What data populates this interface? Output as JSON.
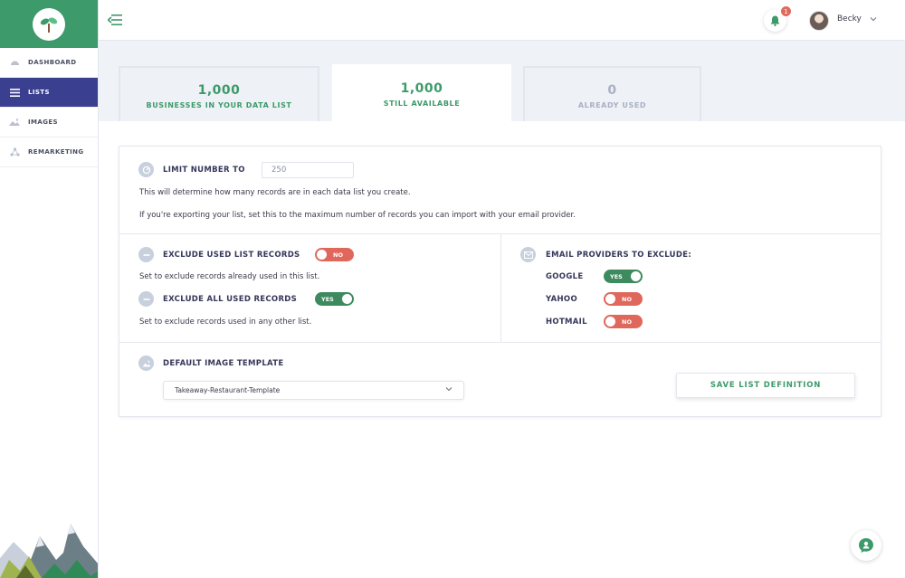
{
  "sidebar": {
    "items": [
      {
        "label": "DASHBOARD",
        "icon": "gauge-icon",
        "active": false
      },
      {
        "label": "LISTS",
        "icon": "list-icon",
        "active": true
      },
      {
        "label": "IMAGES",
        "icon": "image-icon",
        "active": false
      },
      {
        "label": "REMARKETING",
        "icon": "network-icon",
        "active": false
      }
    ]
  },
  "header": {
    "notification_count": "1",
    "user_name": "Becky"
  },
  "stats": [
    {
      "value": "1,000",
      "label": "BUSINESSES IN YOUR DATA LIST"
    },
    {
      "value": "1,000",
      "label": "STILL AVAILABLE"
    },
    {
      "value": "0",
      "label": "ALREADY USED"
    }
  ],
  "limit": {
    "label": "LIMIT NUMBER TO",
    "value": "250",
    "help1": "This will determine how many records are in each data list you create.",
    "help2": "If you're exporting your list, set this to the maximum number of records you can import with your email provider."
  },
  "exclude_used": {
    "label": "EXCLUDE USED LIST RECORDS",
    "toggle": "NO",
    "help": "Set to exclude records already used in this list."
  },
  "exclude_all": {
    "label": "EXCLUDE ALL USED RECORDS",
    "toggle": "YES",
    "help": "Set to exclude records used in any other list."
  },
  "providers": {
    "label": "EMAIL PROVIDERS TO EXCLUDE:",
    "items": [
      {
        "name": "GOOGLE",
        "toggle": "YES"
      },
      {
        "name": "YAHOO",
        "toggle": "NO"
      },
      {
        "name": "HOTMAIL",
        "toggle": "NO"
      }
    ]
  },
  "template": {
    "label": "DEFAULT IMAGE TEMPLATE",
    "selected": "Takeaway-Restaurant-Template"
  },
  "save_label": "SAVE LIST DEFINITION",
  "colors": {
    "brand_green": "#3d9a6a",
    "nav_active": "#3b3f8f",
    "toggle_off": "#e0675b",
    "toggle_on": "#3d8a5f"
  }
}
